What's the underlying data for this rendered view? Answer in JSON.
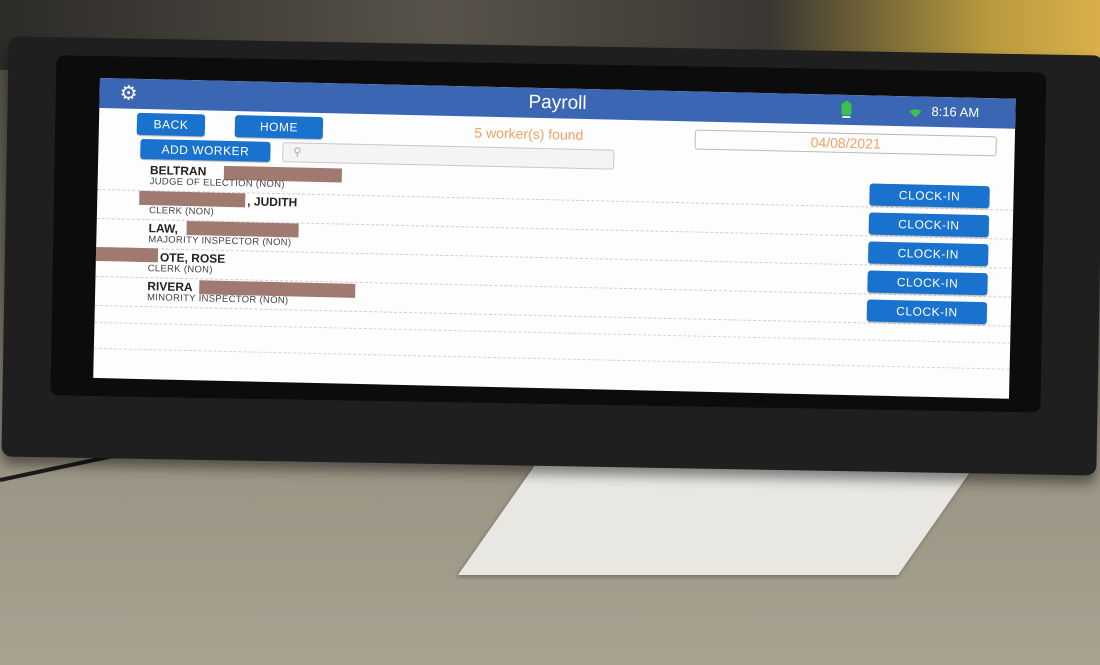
{
  "header": {
    "title": "Payroll",
    "time": "8:16 AM",
    "battery_icon": "battery-charging-icon",
    "wifi_icon": "wifi-icon",
    "settings_icon": "gear-icon",
    "bar_color": "#3a66b4"
  },
  "toolbar": {
    "back_label": "BACK",
    "home_label": "HOME",
    "add_worker_label": "ADD WORKER",
    "found_text": "5 worker(s) found",
    "date": "04/08/2021",
    "search_placeholder": ""
  },
  "workers": [
    {
      "name": "BELTRAN",
      "role": "JUDGE OF ELECTION (NON)",
      "action": "CLOCK-IN"
    },
    {
      "name": ", JUDITH",
      "role": "CLERK (NON)",
      "action": "CLOCK-IN"
    },
    {
      "name": "LAW,",
      "role": "MAJORITY INSPECTOR (NON)",
      "action": "CLOCK-IN"
    },
    {
      "name": "OTE, ROSE",
      "role": "CLERK (NON)",
      "action": "CLOCK-IN"
    },
    {
      "name": "RIVERA",
      "role": "MINORITY INSPECTOR (NON)",
      "action": "CLOCK-IN"
    }
  ],
  "colors": {
    "button": "#1a72cf",
    "accent_text": "#f0a264"
  }
}
